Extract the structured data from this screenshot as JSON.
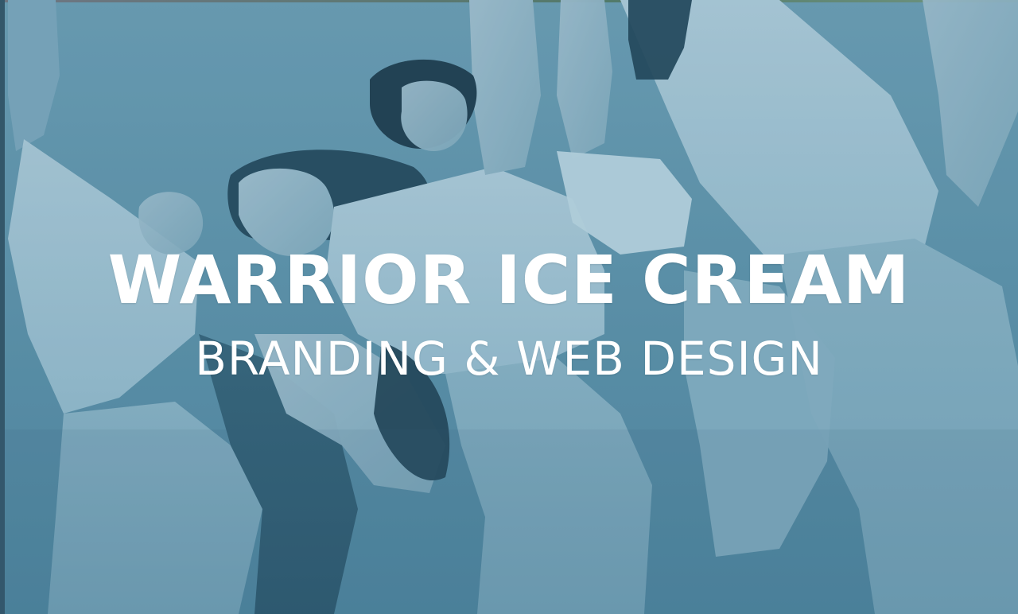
{
  "hero": {
    "title": "WARRIOR ICE CREAM",
    "subtitle": "BRANDING & WEB DESIGN",
    "overlay_color": "#4f859e",
    "text_color": "#ffffff"
  }
}
